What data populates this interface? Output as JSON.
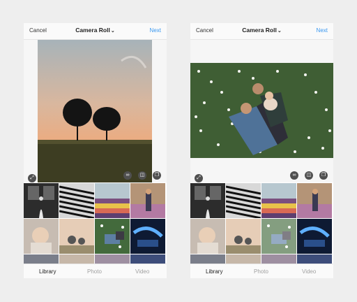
{
  "screens": [
    {
      "header": {
        "cancel_label": "Cancel",
        "title": "Camera Roll",
        "next_label": "Next"
      },
      "tabs": [
        {
          "label": "Library",
          "active": true
        },
        {
          "label": "Photo",
          "active": false
        },
        {
          "label": "Video",
          "active": false
        }
      ],
      "preview": "sunset-trees-photo",
      "tool_icons": [
        "expand-icon",
        "infinity-icon",
        "layout-icon",
        "multi-select-icon"
      ]
    },
    {
      "header": {
        "cancel_label": "Cancel",
        "title": "Camera Roll",
        "next_label": "Next"
      },
      "tabs": [
        {
          "label": "Library",
          "active": true
        },
        {
          "label": "Photo",
          "active": false
        },
        {
          "label": "Video",
          "active": false
        }
      ],
      "preview": "family-flowers-photo",
      "tool_icons": [
        "expand-icon",
        "infinity-icon",
        "layout-icon",
        "multi-select-icon"
      ]
    }
  ],
  "colors": {
    "accent": "#3897f0",
    "background": "#eeeeee"
  }
}
